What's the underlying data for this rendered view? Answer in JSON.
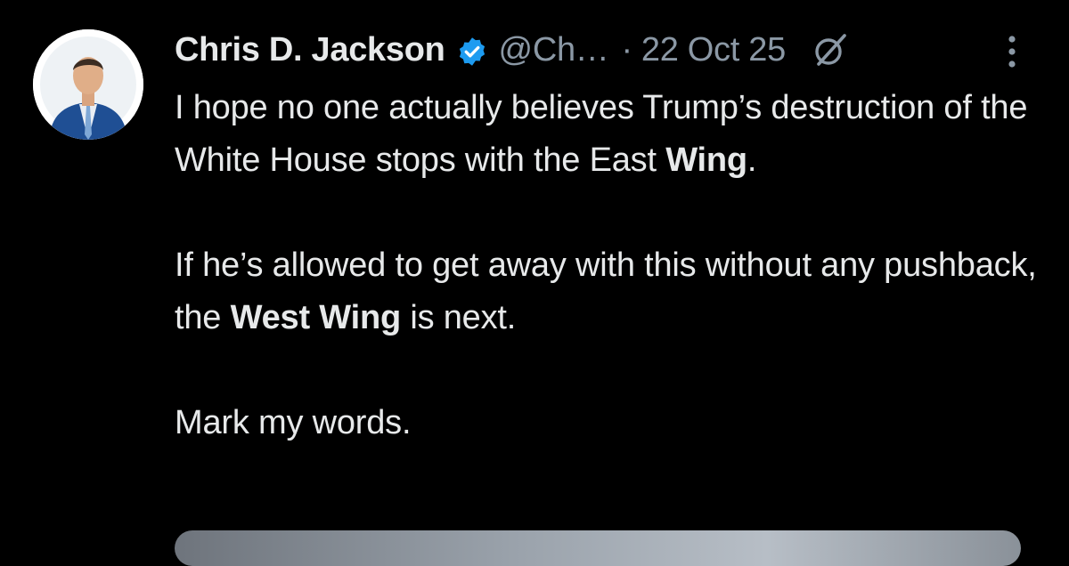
{
  "tweet": {
    "author": {
      "display_name": "Chris D. Jackson",
      "handle": "@Ch…",
      "verified_icon": "verified-badge-icon",
      "avatar_icon": "avatar"
    },
    "separator": "·",
    "date": "22 Oct 25",
    "grok_icon": "grok-icon",
    "more_icon": "more-vertical-icon",
    "text": {
      "p1_a": "I hope no one actually believes Trump’s destruction of the White House stops with the East ",
      "p1_bold": "Wing",
      "p1_b": ".",
      "p2_a": "If he’s allowed to get away with this without any pushback, the ",
      "p2_bold": "West Wing",
      "p2_b": " is next.",
      "p3": "Mark my words."
    }
  },
  "colors": {
    "background": "#000000",
    "text_primary": "#e7e9ea",
    "text_secondary": "#8b98a5",
    "verified_blue": "#1d9bf0"
  }
}
